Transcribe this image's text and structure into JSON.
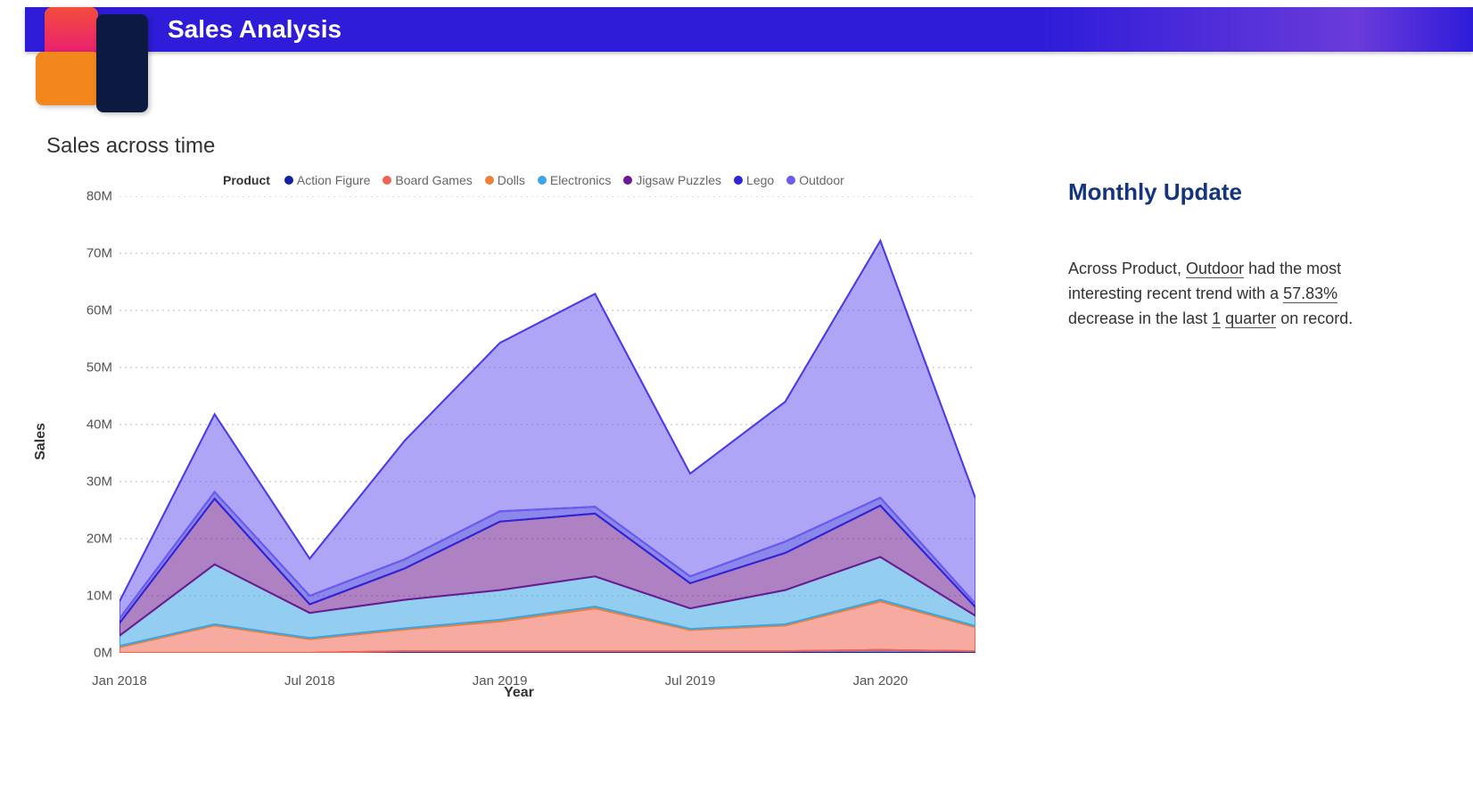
{
  "header": {
    "title": "Sales Analysis"
  },
  "chart_title": "Sales across time",
  "legend_label": "Product",
  "legend": [
    {
      "name": "Action Figure",
      "color": "#12239e"
    },
    {
      "name": "Board Games",
      "color": "#f06452"
    },
    {
      "name": "Dolls",
      "color": "#ed8137"
    },
    {
      "name": "Electronics",
      "color": "#3aa6e5"
    },
    {
      "name": "Jigsaw Puzzles",
      "color": "#6b1a8f"
    },
    {
      "name": "Lego",
      "color": "#2e24d9"
    },
    {
      "name": "Outdoor",
      "color": "#6b5bf0"
    }
  ],
  "chart_data": {
    "type": "area",
    "stacked": true,
    "title": "Sales across time",
    "xlabel": "Year",
    "ylabel": "Sales",
    "ylim": [
      0,
      80000000
    ],
    "x": [
      "Jan 2018",
      "Apr 2018",
      "Jul 2018",
      "Oct 2018",
      "Jan 2019",
      "Apr 2019",
      "Jul 2019",
      "Oct 2019",
      "Jan 2020",
      "Apr 2020"
    ],
    "x_ticks_shown": [
      "Jan 2018",
      "Jul 2018",
      "Jan 2019",
      "Jul 2019",
      "Jan 2020"
    ],
    "y_ticks": [
      "0M",
      "10M",
      "20M",
      "30M",
      "40M",
      "50M",
      "60M",
      "70M",
      "80M"
    ],
    "series": [
      {
        "name": "Action Figure",
        "color": "#12239e",
        "values": [
          0,
          0,
          0,
          300000,
          300000,
          300000,
          300000,
          300000,
          500000,
          300000
        ]
      },
      {
        "name": "Board Games",
        "color": "#f06452",
        "values": [
          1000000,
          4800000,
          2400000,
          3800000,
          5200000,
          7500000,
          3700000,
          4500000,
          8500000,
          4200000
        ]
      },
      {
        "name": "Dolls",
        "color": "#ed8137",
        "values": [
          200000,
          200000,
          200000,
          200000,
          300000,
          300000,
          200000,
          200000,
          300000,
          200000
        ]
      },
      {
        "name": "Electronics",
        "color": "#3aa6e5",
        "values": [
          1800000,
          10500000,
          4400000,
          5000000,
          5200000,
          5300000,
          3600000,
          6000000,
          7500000,
          1800000
        ]
      },
      {
        "name": "Jigsaw Puzzles",
        "color": "#6b1a8f",
        "values": [
          2200000,
          11500000,
          1500000,
          5500000,
          12000000,
          11000000,
          4400000,
          6500000,
          9000000,
          1500000
        ]
      },
      {
        "name": "Lego",
        "color": "#2e24d9",
        "values": [
          800000,
          1200000,
          1500000,
          1600000,
          1800000,
          1200000,
          1200000,
          2000000,
          1400000,
          600000
        ]
      },
      {
        "name": "Outdoor",
        "color": "#6b5bf0",
        "values": [
          3000000,
          13600000,
          6500000,
          20800000,
          29500000,
          37300000,
          18000000,
          24500000,
          45000000,
          18500000
        ]
      }
    ]
  },
  "panel": {
    "title": "Monthly Update",
    "text_pre": "Across Product, ",
    "product": "Outdoor",
    "text_mid": " had the most interesting recent trend with a ",
    "percent": "57.83%",
    "text_mid2": " decrease in the last ",
    "count": "1",
    "unit": "quarter",
    "text_post": " on record."
  }
}
